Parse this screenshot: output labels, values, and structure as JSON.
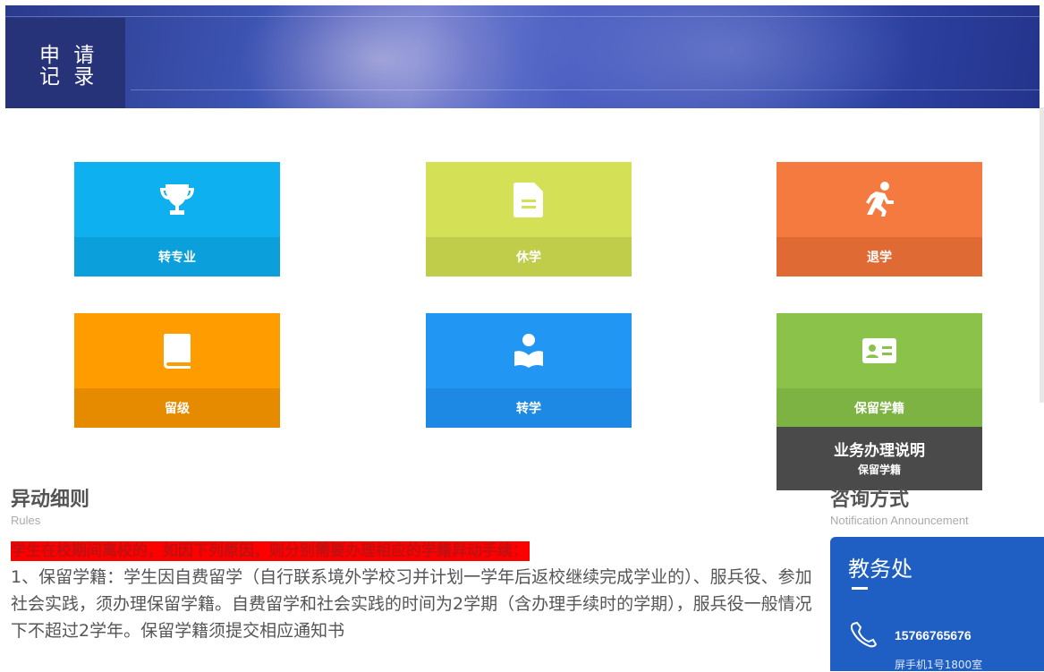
{
  "header": {
    "title_line1": "申 请",
    "title_line2": "记 录"
  },
  "tiles": [
    {
      "label": "转专业",
      "icon": "trophy-icon",
      "top_color": "#0fb0ef",
      "bottom_color": "#0b9fdb"
    },
    {
      "label": "休学",
      "icon": "document-icon",
      "top_color": "#d4e157",
      "bottom_color": "#c0cd4a"
    },
    {
      "label": "退学",
      "icon": "running-person-icon",
      "top_color": "#f47a40",
      "bottom_color": "#e06a34"
    },
    {
      "label": "留级",
      "icon": "book-icon",
      "top_color": "#ff9c00",
      "bottom_color": "#e68a00"
    },
    {
      "label": "转学",
      "icon": "reading-person-icon",
      "top_color": "#2196f3",
      "bottom_color": "#1e88e5"
    },
    {
      "label": "保留学籍",
      "icon": "id-card-icon",
      "top_color": "#8bc34a",
      "bottom_color": "#7cb342"
    }
  ],
  "popup": {
    "title": "业务办理说明",
    "subtitle": "保留学籍"
  },
  "rules_section": {
    "title": "异动细则",
    "subtitle": "Rules",
    "highlight": "学生在校期间离校的，如因下列原因，则分别需要办理相应的学籍异动手续：",
    "text": "1、保留学籍：学生因自费留学（自行联系境外学校习并计划一学年后返校继续完成学业的）、服兵役、参加社会实践，须办理保留学籍。自费留学和社会实践的时间为2学期（含办理手续时的学期），服兵役一般情况下不超过2学年。保留学籍须提交相应通知书"
  },
  "contact_section": {
    "title": "咨询方式",
    "subtitle": "Notification Announcement",
    "office": "教务处",
    "phone": "15766765676",
    "extra": "屏手机1号1800室"
  }
}
